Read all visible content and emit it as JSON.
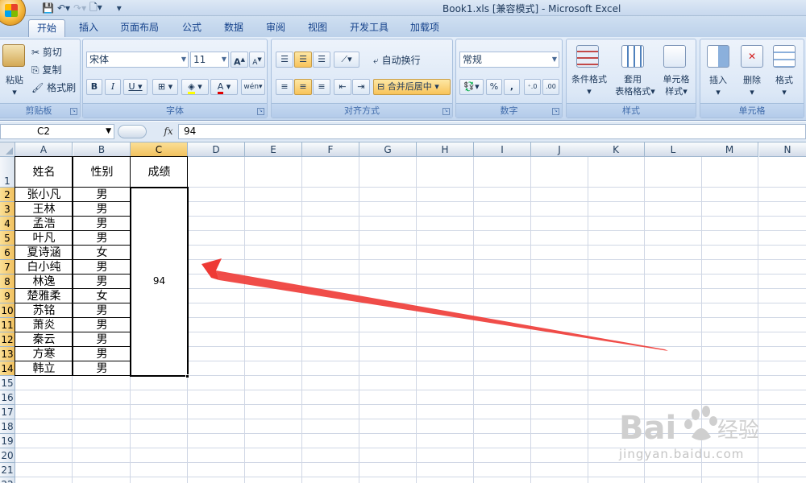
{
  "window": {
    "title": "Book1.xls  [兼容模式] - Microsoft Excel"
  },
  "tabs": [
    {
      "label": "开始",
      "active": true
    },
    {
      "label": "插入"
    },
    {
      "label": "页面布局"
    },
    {
      "label": "公式"
    },
    {
      "label": "数据"
    },
    {
      "label": "审阅"
    },
    {
      "label": "视图"
    },
    {
      "label": "开发工具"
    },
    {
      "label": "加载项"
    }
  ],
  "ribbon": {
    "clipboard": {
      "label": "剪贴板",
      "paste": "粘贴",
      "cut": "剪切",
      "copy": "复制",
      "format_painter": "格式刷"
    },
    "font": {
      "label": "字体",
      "name": "宋体",
      "size": "11",
      "bold": "B",
      "italic": "I",
      "underline": "U",
      "grow": "A",
      "shrink": "A",
      "phonetic": "wén"
    },
    "alignment": {
      "label": "对齐方式",
      "wrap_text": "自动换行",
      "merge_center": "合并后居中"
    },
    "number": {
      "label": "数字",
      "format": "常规",
      "percent": "%",
      "comma": ","
    },
    "styles": {
      "label": "样式",
      "conditional": "条件格式",
      "table_format": [
        "套用",
        "表格格式"
      ],
      "cell_styles": [
        "单元格",
        "样式"
      ]
    },
    "cells": {
      "label": "单元格",
      "insert": "插入",
      "delete": "删除",
      "format": "格式"
    }
  },
  "formula_bar": {
    "name_box": "C2",
    "fx": "fx",
    "value": "94"
  },
  "columns": [
    "A",
    "B",
    "C",
    "D",
    "E",
    "F",
    "G",
    "H",
    "I",
    "J",
    "K",
    "L",
    "M",
    "N"
  ],
  "selected_column": "C",
  "rows": [
    "1",
    "2",
    "3",
    "4",
    "5",
    "6",
    "7",
    "8",
    "9",
    "10",
    "11",
    "12",
    "13",
    "14",
    "15",
    "16",
    "17",
    "18",
    "19",
    "20",
    "21",
    "22"
  ],
  "table": {
    "headers": [
      "姓名",
      "性别",
      "成绩"
    ],
    "rows": [
      [
        "张小凡",
        "男"
      ],
      [
        "王林",
        "男"
      ],
      [
        "孟浩",
        "男"
      ],
      [
        "叶凡",
        "男"
      ],
      [
        "夏诗涵",
        "女"
      ],
      [
        "白小纯",
        "男"
      ],
      [
        "林逸",
        "男"
      ],
      [
        "楚雅柔",
        "女"
      ],
      [
        "苏铭",
        "男"
      ],
      [
        "萧炎",
        "男"
      ],
      [
        "秦云",
        "男"
      ],
      [
        "方寒",
        "男"
      ],
      [
        "韩立",
        "男"
      ]
    ],
    "merged_value": "94"
  },
  "watermark": {
    "brand": "Bai",
    "brand_cn": "经验",
    "url": "jingyan.baidu.com"
  }
}
